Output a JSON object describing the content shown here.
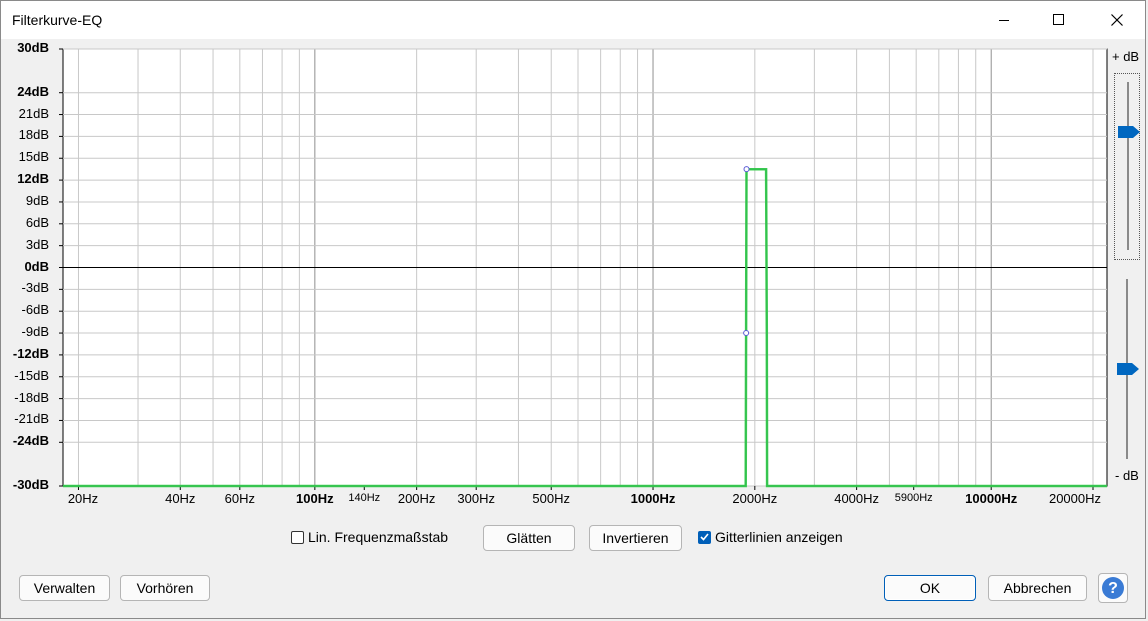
{
  "window": {
    "title": "Filterkurve-EQ",
    "minimize_icon": "minimize-icon",
    "maximize_icon": "maximize-icon",
    "close_icon": "close-icon"
  },
  "graph": {
    "y_labels": [
      {
        "text": "30dB",
        "bold": true,
        "db": 30
      },
      {
        "text": "24dB",
        "bold": true,
        "db": 24
      },
      {
        "text": "21dB",
        "bold": false,
        "db": 21
      },
      {
        "text": "18dB",
        "bold": false,
        "db": 18
      },
      {
        "text": "15dB",
        "bold": false,
        "db": 15
      },
      {
        "text": "12dB",
        "bold": true,
        "db": 12
      },
      {
        "text": "9dB",
        "bold": false,
        "db": 9
      },
      {
        "text": "6dB",
        "bold": false,
        "db": 6
      },
      {
        "text": "3dB",
        "bold": false,
        "db": 3
      },
      {
        "text": "0dB",
        "bold": true,
        "db": 0
      },
      {
        "text": "-3dB",
        "bold": false,
        "db": -3
      },
      {
        "text": "-6dB",
        "bold": false,
        "db": -6
      },
      {
        "text": "-9dB",
        "bold": false,
        "db": -9
      },
      {
        "text": "-12dB",
        "bold": true,
        "db": -12
      },
      {
        "text": "-15dB",
        "bold": false,
        "db": -15
      },
      {
        "text": "-18dB",
        "bold": false,
        "db": -18
      },
      {
        "text": "-21dB",
        "bold": false,
        "db": -21
      },
      {
        "text": "-24dB",
        "bold": true,
        "db": -24
      },
      {
        "text": "-30dB",
        "bold": true,
        "db": -30
      }
    ],
    "x_labels": [
      {
        "text": "20Hz",
        "hz": 20,
        "style": "normal"
      },
      {
        "text": "40Hz",
        "hz": 40,
        "style": "normal"
      },
      {
        "text": "60Hz",
        "hz": 60,
        "style": "normal"
      },
      {
        "text": "100Hz",
        "hz": 100,
        "style": "bold"
      },
      {
        "text": "140Hz",
        "hz": 140,
        "style": "small"
      },
      {
        "text": "200Hz",
        "hz": 200,
        "style": "normal"
      },
      {
        "text": "300Hz",
        "hz": 300,
        "style": "normal"
      },
      {
        "text": "500Hz",
        "hz": 500,
        "style": "normal"
      },
      {
        "text": "1000Hz",
        "hz": 1000,
        "style": "bold"
      },
      {
        "text": "2000Hz",
        "hz": 2000,
        "style": "normal"
      },
      {
        "text": "4000Hz",
        "hz": 4000,
        "style": "normal"
      },
      {
        "text": "5900Hz",
        "hz": 5900,
        "style": "small"
      },
      {
        "text": "10000Hz",
        "hz": 10000,
        "style": "bold"
      },
      {
        "text": "20000Hz",
        "hz": 20000,
        "style": "normal"
      }
    ],
    "plus_db_label": "+ dB",
    "minus_db_label": "- dB",
    "curve_color": "#2ecc40",
    "handle_color": "#5b5bd6"
  },
  "chart_data": {
    "type": "line",
    "xlim": [
      18,
      22000
    ],
    "ylim": [
      -30,
      30
    ],
    "x_scale": "log",
    "grid": true,
    "series": [
      {
        "points": [
          [
            18,
            -30
          ],
          [
            1880,
            -30
          ],
          [
            1885,
            -9
          ],
          [
            1890,
            13.5
          ],
          [
            2160,
            13.5
          ],
          [
            2170,
            -9
          ],
          [
            2175,
            -30
          ],
          [
            22000,
            -30
          ]
        ]
      }
    ]
  },
  "sliders": {
    "upper_value": 12,
    "lower_value": 0
  },
  "controls": {
    "lin_freq_label": "Lin. Frequenzmaßstab",
    "lin_freq_checked": false,
    "smooth_button": "Glätten",
    "invert_button": "Invertieren",
    "grid_label": "Gitterlinien anzeigen",
    "grid_checked": true
  },
  "footer": {
    "manage_button": "Verwalten",
    "preview_button": "Vorhören",
    "ok_button": "OK",
    "cancel_button": "Abbrechen",
    "help_icon": "help-icon"
  }
}
